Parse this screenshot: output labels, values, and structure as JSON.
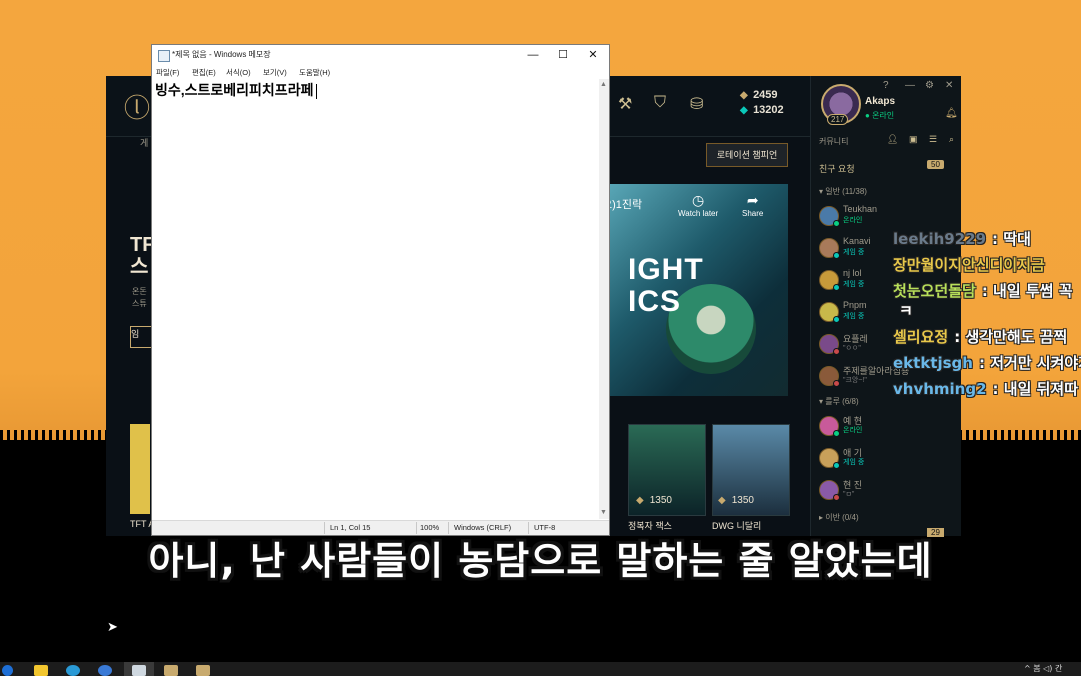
{
  "notepad": {
    "title": "*제목 없음 - Windows 메모장",
    "menu": [
      "파일(F)",
      "편집(E)",
      "서식(O)",
      "보기(V)",
      "도움말(H)"
    ],
    "content": "빙수,스트로베리피치프라페",
    "status": {
      "position": "Ln 1, Col 15",
      "zoom": "100%",
      "line_ending": "Windows (CRLF)",
      "encoding": "UTF-8"
    }
  },
  "lol": {
    "play_tab": "게",
    "currency": {
      "rp": "2459",
      "be": "13202"
    },
    "rotation_button": "로테이션 챔피언",
    "tft": {
      "title": "TFT\n스",
      "sub": "온돈\n스튜",
      "button": "임",
      "card_label": "TFT A"
    },
    "video": {
      "title": "오)1진락",
      "big_text": "IGHT\nICS",
      "watch_later": "Watch later",
      "share": "Share"
    },
    "shop": [
      {
        "price": "1350",
        "name": "정복자 잭스",
        "color": "#2a6a55"
      },
      {
        "price": "1350",
        "name": "DWG 니달리",
        "color": "#5a8aa8"
      }
    ],
    "profile": {
      "name": "Akaps",
      "status": "온라인",
      "level": "217"
    },
    "community_label": "커뮤니티",
    "friend_requests": {
      "label": "친구 요청",
      "count": "50"
    },
    "groups": [
      {
        "label": "▾ 일반 (11/38)"
      },
      {
        "label": "▾ 를루 (6/8)"
      },
      {
        "label": "▸ 이반 (0/4)"
      }
    ],
    "friends_general": [
      {
        "name": "Teukhan",
        "status": "온라인",
        "kind": "online",
        "color": "#4a7aa8"
      },
      {
        "name": "Kanavi",
        "status": "게임 중",
        "kind": "game",
        "color": "#a87a5a"
      },
      {
        "name": "nj lol",
        "status": "게임 중",
        "kind": "game",
        "color": "#c89a3a"
      },
      {
        "name": "Pnpm",
        "status": "게임 중",
        "kind": "game",
        "color": "#c8b84a"
      },
      {
        "name": "요플레",
        "status": "\"ㅇㅇ\"",
        "kind": "gray",
        "color": "#7a4a8a"
      },
      {
        "name": "주제를알아라집숑",
        "status": "\"크앙~!\"",
        "kind": "gray",
        "color": "#8a5a3a"
      }
    ],
    "friends_blue": [
      {
        "name": "예 현",
        "status": "온라인",
        "kind": "online",
        "color": "#c85a9a"
      },
      {
        "name": "애 기",
        "status": "게임 중",
        "kind": "game",
        "color": "#c8a05a"
      },
      {
        "name": "현 진",
        "status": "\"ㅁ\"",
        "kind": "gray",
        "color": "#8a5aa8"
      }
    ],
    "bottom_badge": "29"
  },
  "chat": [
    {
      "user": "leekih9229",
      "msg": "딱대",
      "color": "#6a7a8a"
    },
    {
      "user": "장만월이지안신디이지금",
      "msg": "",
      "color": "#e8c84a"
    },
    {
      "user": "첫눈오던돌담",
      "msg": "내일 투썸 꼭",
      "color": "#b8e05a"
    },
    {
      "user": "",
      "msg": "ㅋ",
      "color": "#ffffff"
    },
    {
      "user": "셀리요정",
      "msg": "생각만해도 끔찍",
      "color": "#e8c84a"
    },
    {
      "user": "ektktjsgh",
      "msg": "저거만 시켜야지",
      "color": "#6ab8e8"
    },
    {
      "user": "vhvhming2",
      "msg": "내일 뒤져따",
      "color": "#6ab8e8"
    }
  ],
  "subtitle": "아니, 난 사람들이 농담으로 말하는 줄 알았는데",
  "taskbar": {
    "tray_text": "^ 봄 ◁) 간"
  }
}
